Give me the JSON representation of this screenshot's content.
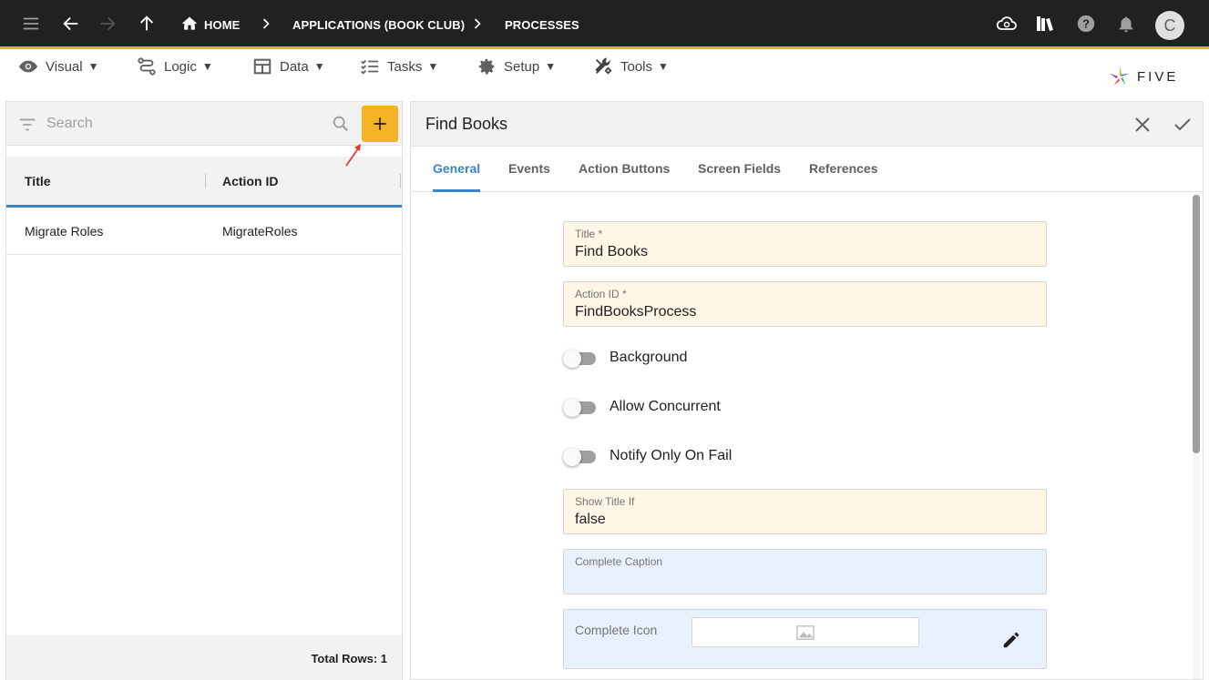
{
  "topbar": {
    "breadcrumbs": [
      "HOME",
      "APPLICATIONS (BOOK CLUB)",
      "PROCESSES"
    ],
    "icons": [
      "menu-icon",
      "back-icon",
      "forward-icon",
      "up-icon",
      "home-icon",
      "cloud-sync-icon",
      "library-icon",
      "help-icon",
      "bell-icon"
    ],
    "avatar_initial": "C",
    "accent_color": "#f5a623"
  },
  "menubar": {
    "items": [
      {
        "label": "Visual",
        "icon": "eye-icon"
      },
      {
        "label": "Logic",
        "icon": "flow-icon"
      },
      {
        "label": "Data",
        "icon": "table-icon"
      },
      {
        "label": "Tasks",
        "icon": "checklist-icon"
      },
      {
        "label": "Setup",
        "icon": "gear-icon"
      },
      {
        "label": "Tools",
        "icon": "tools-icon"
      }
    ],
    "caret": "▼",
    "logo_text": "FIVE"
  },
  "list": {
    "search_placeholder": "Search",
    "columns": [
      "Title",
      "Action ID"
    ],
    "rows": [
      {
        "title": "Migrate Roles",
        "action_id": "MigrateRoles"
      }
    ],
    "total_rows_label": "Total Rows: 1",
    "add_button_color": "#f5b324"
  },
  "form": {
    "title": "Find Books",
    "tabs": [
      "General",
      "Events",
      "Action Buttons",
      "Screen Fields",
      "References"
    ],
    "active_tab": "General",
    "fields": {
      "title": {
        "label": "Title *",
        "value": "Find Books"
      },
      "action_id": {
        "label": "Action ID *",
        "value": "FindBooksProcess"
      },
      "show_title_if": {
        "label": "Show Title If",
        "value": "false"
      },
      "complete_caption": {
        "label": "Complete Caption",
        "value": ""
      },
      "complete_icon": {
        "label": "Complete Icon"
      }
    },
    "toggles": [
      {
        "label": "Background",
        "on": false
      },
      {
        "label": "Allow Concurrent",
        "on": false
      },
      {
        "label": "Notify Only On Fail",
        "on": false
      }
    ],
    "required_bg": "#fff6e5",
    "optional_bg": "#e8f1fb"
  }
}
